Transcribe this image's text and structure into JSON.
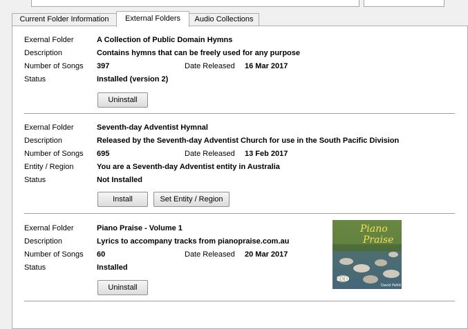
{
  "tabs": [
    "Current Folder Information",
    "External Folders",
    "Audio Collections"
  ],
  "active_tab": "External Folders",
  "labels": {
    "folder": "Exernal Folder",
    "description": "Description",
    "songs": "Number of Songs",
    "date": "Date Released",
    "entity": "Entity / Region",
    "status": "Status"
  },
  "folders": [
    {
      "name": "A Collection of Public Domain Hymns",
      "description": "Contains hymns that can be freely used for any purpose",
      "songs": "397",
      "date": "16 Mar 2017",
      "status": "Installed (version 2)",
      "buttons": [
        "Uninstall"
      ]
    },
    {
      "name": "Seventh-day Adventist Hymnal",
      "description": "Released by the Seventh-day Adventist Church for use in the South Pacific Division",
      "songs": "695",
      "date": "13 Feb 2017",
      "entity": "You are a Seventh-day Adventist entity in Australia",
      "status": "Not Installed",
      "buttons": [
        "Install",
        "Set Entity / Region"
      ]
    },
    {
      "name": "Piano Praise - Volume 1",
      "description": "Lyrics to accompany tracks from pianopraise.com.au",
      "songs": "60",
      "date": "20 Mar 2017",
      "status": "Installed",
      "buttons": [
        "Uninstall"
      ],
      "album_art": {
        "title_line1": "Piano",
        "title_line2": "Praise",
        "badge": "2CD",
        "artist": "David Pettit"
      }
    }
  ],
  "colors": {
    "panel_bg": "#ffffff",
    "window_bg": "#f0f0f0",
    "divider": "#a0a0a0"
  }
}
